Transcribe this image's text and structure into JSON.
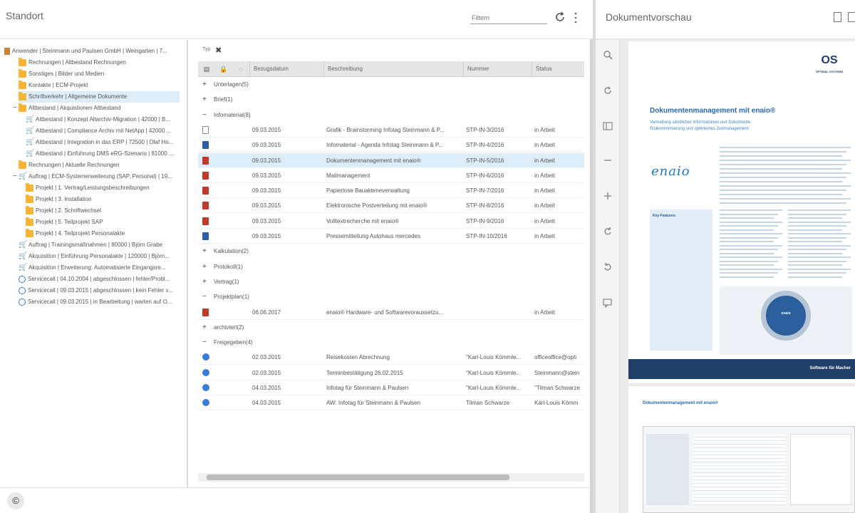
{
  "left_panel": {
    "title": "Standort",
    "filter_placeholder": "Filtern"
  },
  "tree": [
    {
      "label": "Anwender | Steinmann und Paulsen GmbH | Weingarten | 7...",
      "icon": "cabinet-icon",
      "level": 0
    },
    {
      "label": "Rechnungen | Altbestand Rechnungen",
      "icon": "folder-icon",
      "level": 1
    },
    {
      "label": "Sonstiges | Bilder und Medien",
      "icon": "folder-icon",
      "level": 1
    },
    {
      "label": "Kontakte | ECM-Projekt",
      "icon": "folder-icon",
      "level": 1
    },
    {
      "label": "Schriftverkehr | Allgemeine Dokumente",
      "icon": "folder-icon",
      "level": 1,
      "selected": true
    },
    {
      "label": "Altbestand | Akquistionen Altbestand",
      "icon": "folder-icon",
      "level": 1,
      "toggle": "−"
    },
    {
      "label": "Altbestand | Konzept Altarchiv-Migration | 42000 | B...",
      "icon": "cart-icon",
      "level": 2
    },
    {
      "label": "Altbestand | Compliance Archiv mit NetApp | 42000 ...",
      "icon": "cart-icon",
      "level": 2
    },
    {
      "label": "Altbestand | Integration in das ERP | 72500 | Olaf Ho...",
      "icon": "cart-icon",
      "level": 2
    },
    {
      "label": "Altbestand | Einführung DMS eRG-Szenario | 81000 ...",
      "icon": "cart-icon",
      "level": 2
    },
    {
      "label": "Rechnungen | Aktuelle Rechnungen",
      "icon": "folder-icon",
      "level": 1
    },
    {
      "label": "Auftrag | ECM-Systemerweiterung (SAP, Personal) | 19...",
      "icon": "cart-icon",
      "level": 1,
      "toggle": "−"
    },
    {
      "label": "Projekt | 1. Vertrag/Leistungsbeschreibungen",
      "icon": "folder-icon",
      "level": 2
    },
    {
      "label": "Projekt | 3. Installation",
      "icon": "folder-icon",
      "level": 2
    },
    {
      "label": "Projekt | 2. Schriftwechsel",
      "icon": "folder-icon",
      "level": 2
    },
    {
      "label": "Projekt | 5. Teilprojekt SAP",
      "icon": "folder-icon",
      "level": 2
    },
    {
      "label": "Projekt | 4. Teilprojekt Personalakte",
      "icon": "folder-icon",
      "level": 2
    },
    {
      "label": "Auftrag | Trainingsmaßnahmen | 80000 | Björn Grabe",
      "icon": "cart-icon",
      "level": 1
    },
    {
      "label": "Akquisition | Einführung Personalakte | 120000 | Björn...",
      "icon": "cart-icon",
      "level": 1
    },
    {
      "label": "Akquisition | Erweiterung: Automatisierte Eingangsre...",
      "icon": "cart-icon",
      "level": 1
    },
    {
      "label": "Servicecall | 04.10.2004 | abgeschlossen | fehler/Probl...",
      "icon": "clock-icon",
      "level": 1
    },
    {
      "label": "Servicecall | 09.03.2015 | abgeschlossen | kein Fehler v...",
      "icon": "clock-icon",
      "level": 1
    },
    {
      "label": "Servicecall | 09.03.2015 | in Bearbeitung | warten auf O...",
      "icon": "clock-icon",
      "level": 1
    }
  ],
  "list": {
    "typ_label": "Typ",
    "columns": {
      "bezugsdatum": "Bezugsdatum",
      "beschreibung": "Beschreibung",
      "nummer": "Nummer",
      "status": "Status"
    },
    "items": [
      {
        "kind": "group",
        "sign": "+",
        "label": "Unterlagen(5)"
      },
      {
        "kind": "group",
        "sign": "+",
        "label": "Brief(1)"
      },
      {
        "kind": "group",
        "sign": "−",
        "label": "Infomaterial(8)"
      },
      {
        "kind": "row",
        "icon": "txt",
        "date": "09.03.2015",
        "desc": "Grafik - Brainstorming Infotag Steinmann & P...",
        "num": "STP-IN-3/2016",
        "status": "in Arbeit"
      },
      {
        "kind": "row",
        "icon": "word",
        "date": "09.03.2015",
        "desc": "Infomaterial - Agenda Infotag Steinmann & P...",
        "num": "STP-IN-4/2016",
        "status": "in Arbeit"
      },
      {
        "kind": "row",
        "icon": "pdf",
        "date": "09.03.2015",
        "desc": "Dokumentenmanagement mit enaio®",
        "num": "STP-IN-5/2016",
        "status": "in Arbeit",
        "selected": true
      },
      {
        "kind": "row",
        "icon": "pdf",
        "date": "09.03.2015",
        "desc": "Mailmanagement",
        "num": "STP-IN-6/2016",
        "status": "in Arbeit"
      },
      {
        "kind": "row",
        "icon": "pdf",
        "date": "09.03.2015",
        "desc": "Papierlose Bauakteneverwaltung",
        "num": "STP-IN-7/2016",
        "status": "in Arbeit"
      },
      {
        "kind": "row",
        "icon": "pdf",
        "date": "09.03.2015",
        "desc": "Elektronische Postverteilung mit enaio®",
        "num": "STP-IN-8/2016",
        "status": "in Arbeit"
      },
      {
        "kind": "row",
        "icon": "pdf",
        "date": "09.03.2015",
        "desc": "Volltextrecherche mit enaio®",
        "num": "STP-IN-9/2016",
        "status": "in Arbeit"
      },
      {
        "kind": "row",
        "icon": "word",
        "date": "09.03.2015",
        "desc": "Pressemitteilung Autohaus mercedes",
        "num": "STP-IN-10/2016",
        "status": "in Arbeit"
      },
      {
        "kind": "group",
        "sign": "+",
        "label": "Kalkulation(2)"
      },
      {
        "kind": "group",
        "sign": "+",
        "label": "Protokoll(1)"
      },
      {
        "kind": "group",
        "sign": "+",
        "label": "Vertrag(1)"
      },
      {
        "kind": "group",
        "sign": "−",
        "label": "Projektplan(1)"
      },
      {
        "kind": "row",
        "icon": "pdf",
        "date": "06.06.2017",
        "desc": "enaio® Hardware- und Softwarevoraussetzu...",
        "num": "",
        "status": "in Arbeit"
      },
      {
        "kind": "group",
        "sign": "+",
        "label": "archiviert(2)"
      },
      {
        "kind": "group",
        "sign": "−",
        "label": "Freigegeben(4)"
      },
      {
        "kind": "row",
        "icon": "mail",
        "date": "02.03.2015",
        "desc": "Reisekosten Abrechnung",
        "num": "\"Karl-Louis Kömmle...",
        "status": "officeoffice@opti"
      },
      {
        "kind": "row",
        "icon": "mail",
        "date": "02.03.2015",
        "desc": "Terminbestätigung 26.02.2015",
        "num": "\"Karl-Louis Kömmle...",
        "status": "Steinmann@stein"
      },
      {
        "kind": "row",
        "icon": "mail",
        "date": "04.03.2015",
        "desc": "Infotag für Steinmann & Paulsen",
        "num": "\"Karl-Louis Kömmle...",
        "status": "\"Tilman Schwarze"
      },
      {
        "kind": "row",
        "icon": "mail",
        "date": "04.03.2015",
        "desc": "AW: Infotag für Steinmann & Paulsen",
        "num": "Tilman Schwarze",
        "status": "Karl-Louis Kömm"
      }
    ]
  },
  "bottom_bar": {
    "copyright_symbol": "©"
  },
  "preview": {
    "title": "Dokumentvorschau",
    "doc": {
      "logo_main": "OS",
      "logo_sub": "OPTIMAL SYSTEMS",
      "title": "Dokumentenmanagement mit enaio®",
      "subtitle_1": "Verwaltung sämtlicher Informationen und Dokumente",
      "subtitle_2": "Risikominimierung und optimiertes Zeitmanagement",
      "product_logo": "enaio",
      "key_features_heading": "Key Features:",
      "graphic_label": "enaio",
      "banner": "Software für Macher",
      "page2_title": "Dokumentenmanagement mit enaio®"
    }
  },
  "colors": {
    "selection": "#ddeefa",
    "accent": "#2a6ab5",
    "banner": "#1f3f66"
  }
}
